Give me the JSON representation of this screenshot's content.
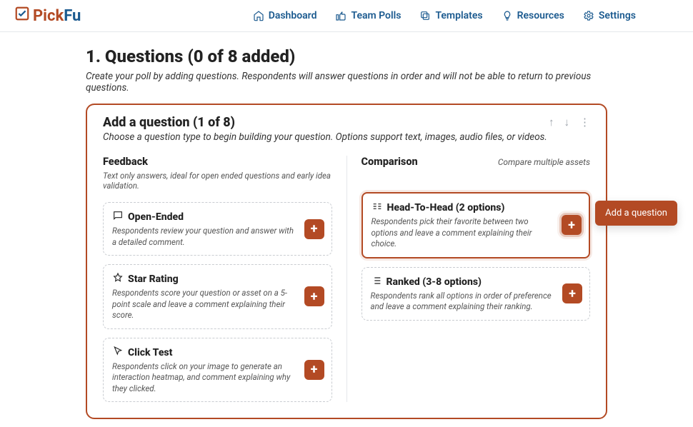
{
  "brand": {
    "pick": "Pick",
    "fu": "Fu"
  },
  "nav": {
    "dashboard": "Dashboard",
    "team_polls": "Team Polls",
    "templates": "Templates",
    "resources": "Resources",
    "settings": "Settings"
  },
  "page": {
    "title": "1. Questions (0 of 8 added)",
    "subtitle": "Create your poll by adding questions. Respondents will answer questions in order and will not be able to return to previous questions."
  },
  "panel": {
    "title": "Add a question (1 of 8)",
    "subtitle": "Choose a question type to begin building your question. Options support text, images, audio files, or videos."
  },
  "feedback": {
    "title": "Feedback",
    "desc": "Text only answers, ideal for open ended questions and early idea validation.",
    "open_ended": {
      "title": "Open-Ended",
      "desc": "Respondents review your question and answer with a detailed comment."
    },
    "star_rating": {
      "title": "Star Rating",
      "desc": "Respondents score your question or asset on a 5-point scale and leave a comment explaining their score."
    },
    "click_test": {
      "title": "Click Test",
      "desc": "Respondents click on your image to generate an interaction heatmap, and comment explaining why they clicked."
    }
  },
  "comparison": {
    "title": "Comparison",
    "hint": "Compare multiple assets",
    "head_to_head": {
      "title": "Head-To-Head (2 options)",
      "desc": "Respondents pick their favorite between two options and leave a comment explaining their choice."
    },
    "ranked": {
      "title": "Ranked (3-8 options)",
      "desc": "Respondents rank all options in order of preference and leave a comment explaining their ranking."
    }
  },
  "tooltip": "Add a question"
}
